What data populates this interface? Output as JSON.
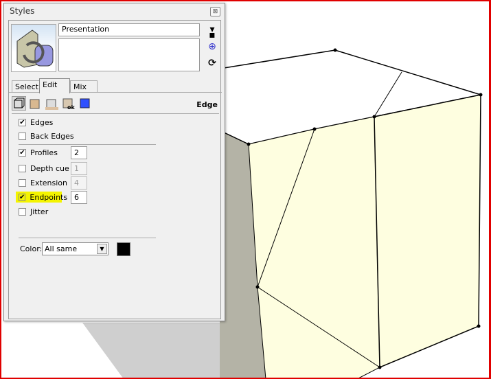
{
  "panel": {
    "title": "Styles",
    "style_name": "Presentation",
    "style_description": ""
  },
  "tabs": [
    {
      "label": "Select"
    },
    {
      "label": "Edit"
    },
    {
      "label": "Mix"
    }
  ],
  "active_tab": "Edit",
  "section_label": "Edge",
  "settings": {
    "edges": {
      "label": "Edges",
      "checked": true
    },
    "back_edges": {
      "label": "Back Edges",
      "checked": false
    },
    "profiles": {
      "label": "Profiles",
      "checked": true,
      "value": "2"
    },
    "depth_cue": {
      "label": "Depth cue",
      "checked": false,
      "value": "1"
    },
    "extension": {
      "label": "Extension",
      "checked": false,
      "value": "4"
    },
    "endpoints": {
      "label": "Endpoints",
      "checked": true,
      "value": "6"
    },
    "jitter": {
      "label": "Jitter",
      "checked": false
    }
  },
  "color": {
    "label": "Color:",
    "selected": "All same",
    "swatch": "#000000"
  },
  "colors": {
    "highlight": "#f4f400",
    "face": "#fefee0",
    "frame": "#e00000"
  }
}
